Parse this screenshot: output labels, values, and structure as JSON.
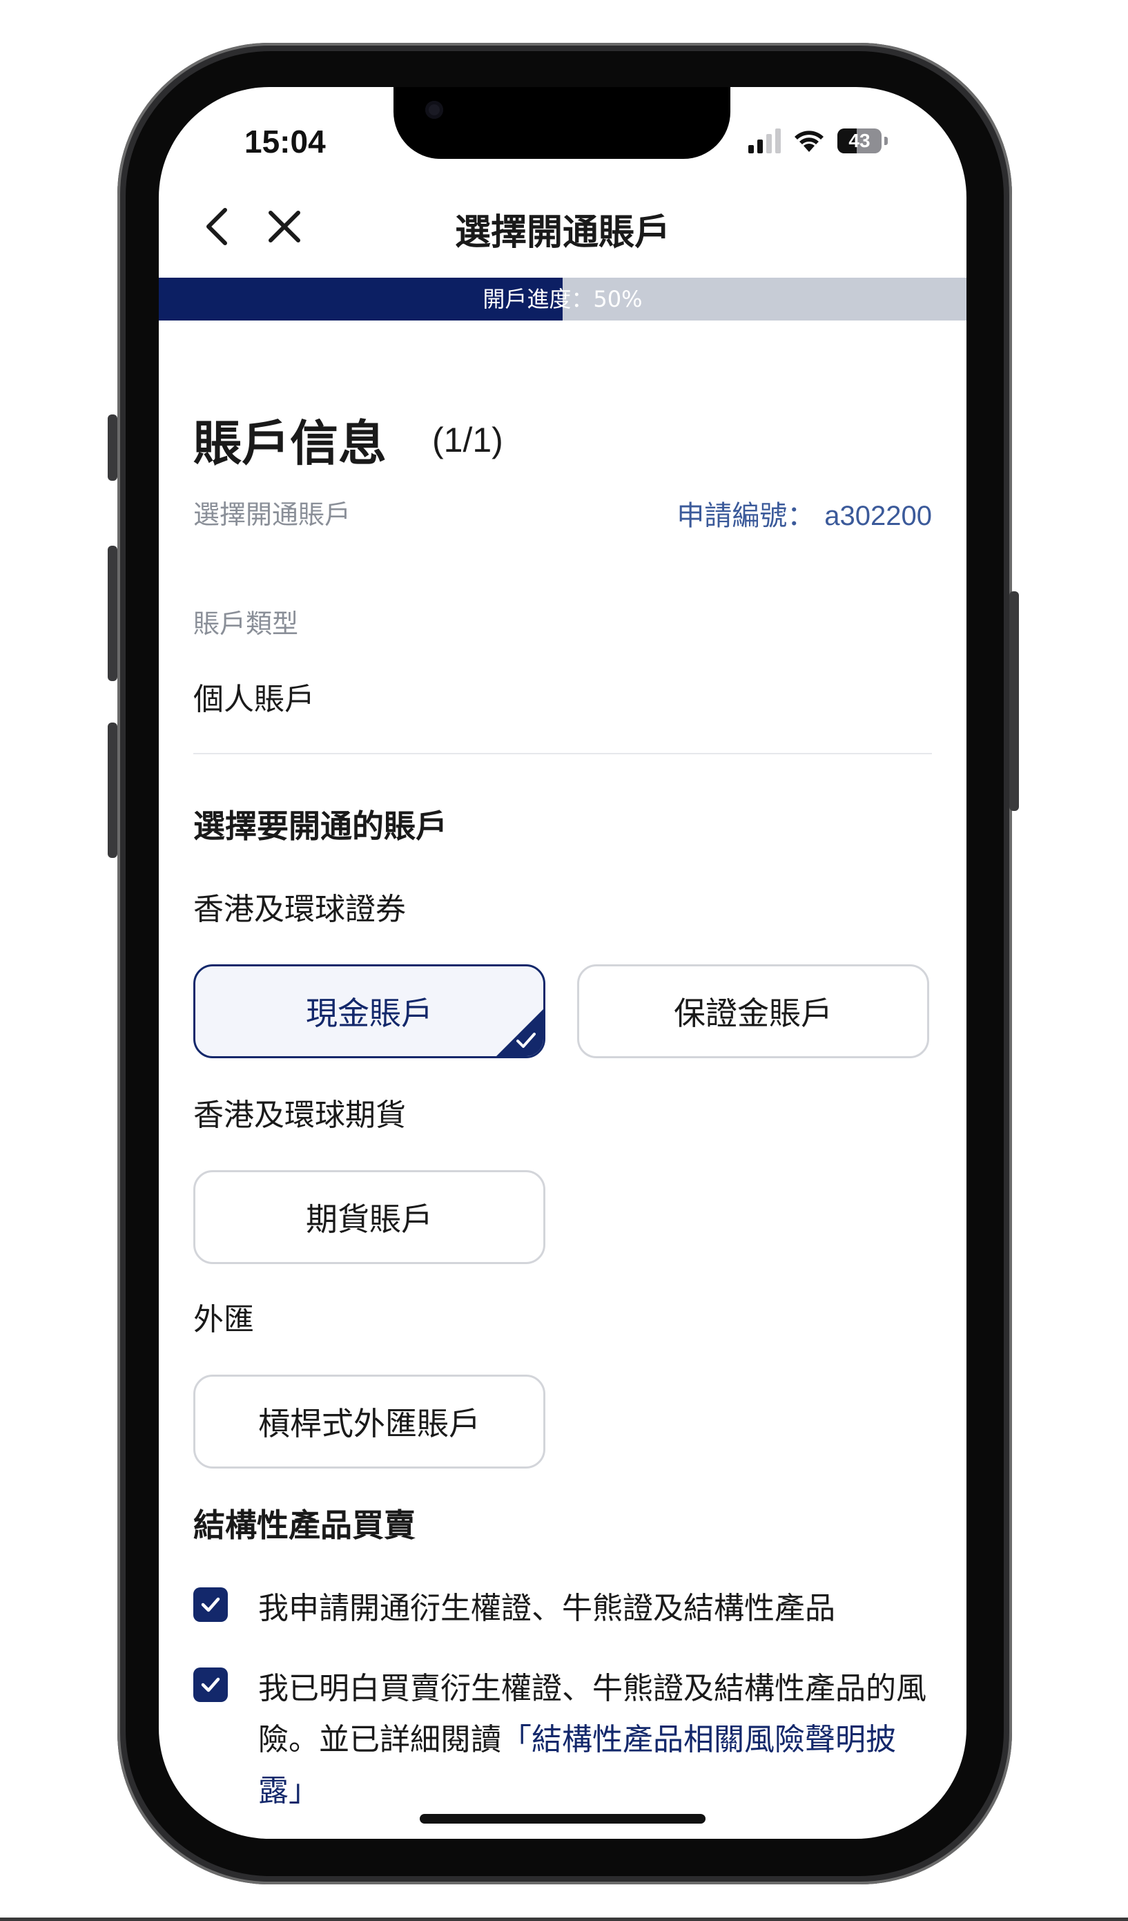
{
  "status_bar": {
    "time": "15:04",
    "battery": "43"
  },
  "nav": {
    "title": "選擇開通賬戶",
    "back_icon": "chevron-left-icon",
    "close_icon": "close-icon"
  },
  "progress": {
    "label": "開戶進度：50%",
    "percent": 50
  },
  "header": {
    "title": "賬戶信息",
    "count": "(1/1)",
    "subtitle": "選擇開通賬戶",
    "application_no_label": "申請編號：",
    "application_no_value": "a302200"
  },
  "account_type": {
    "label": "賬戶類型",
    "value": "個人賬戶"
  },
  "choose": {
    "heading": "選擇要開通的賬戶",
    "groups": [
      {
        "label": "香港及環球證券",
        "options": [
          {
            "label": "現金賬戶",
            "selected": true
          },
          {
            "label": "保證金賬戶",
            "selected": false
          }
        ]
      },
      {
        "label": "香港及環球期貨",
        "options": [
          {
            "label": "期貨賬戶",
            "selected": false
          }
        ]
      },
      {
        "label": "外匯",
        "options": [
          {
            "label": "槓桿式外匯賬戶",
            "selected": false
          }
        ]
      }
    ]
  },
  "structured": {
    "heading": "結構性產品買賣",
    "items": [
      {
        "checked": true,
        "text": "我申請開通衍生權證、牛熊證及結構性產品"
      },
      {
        "checked": true,
        "text": "我已明白買賣衍生權證、牛熊證及結構性產品的風險。並已詳細閱讀",
        "link": "「結構性產品相關風險聲明披露」"
      }
    ]
  },
  "colors": {
    "primary": "#13286b",
    "progress_fill": "#0c1f63",
    "progress_track": "#c7ccd6",
    "muted_text": "#8a8f98",
    "accent_text": "#3b5a9a"
  }
}
